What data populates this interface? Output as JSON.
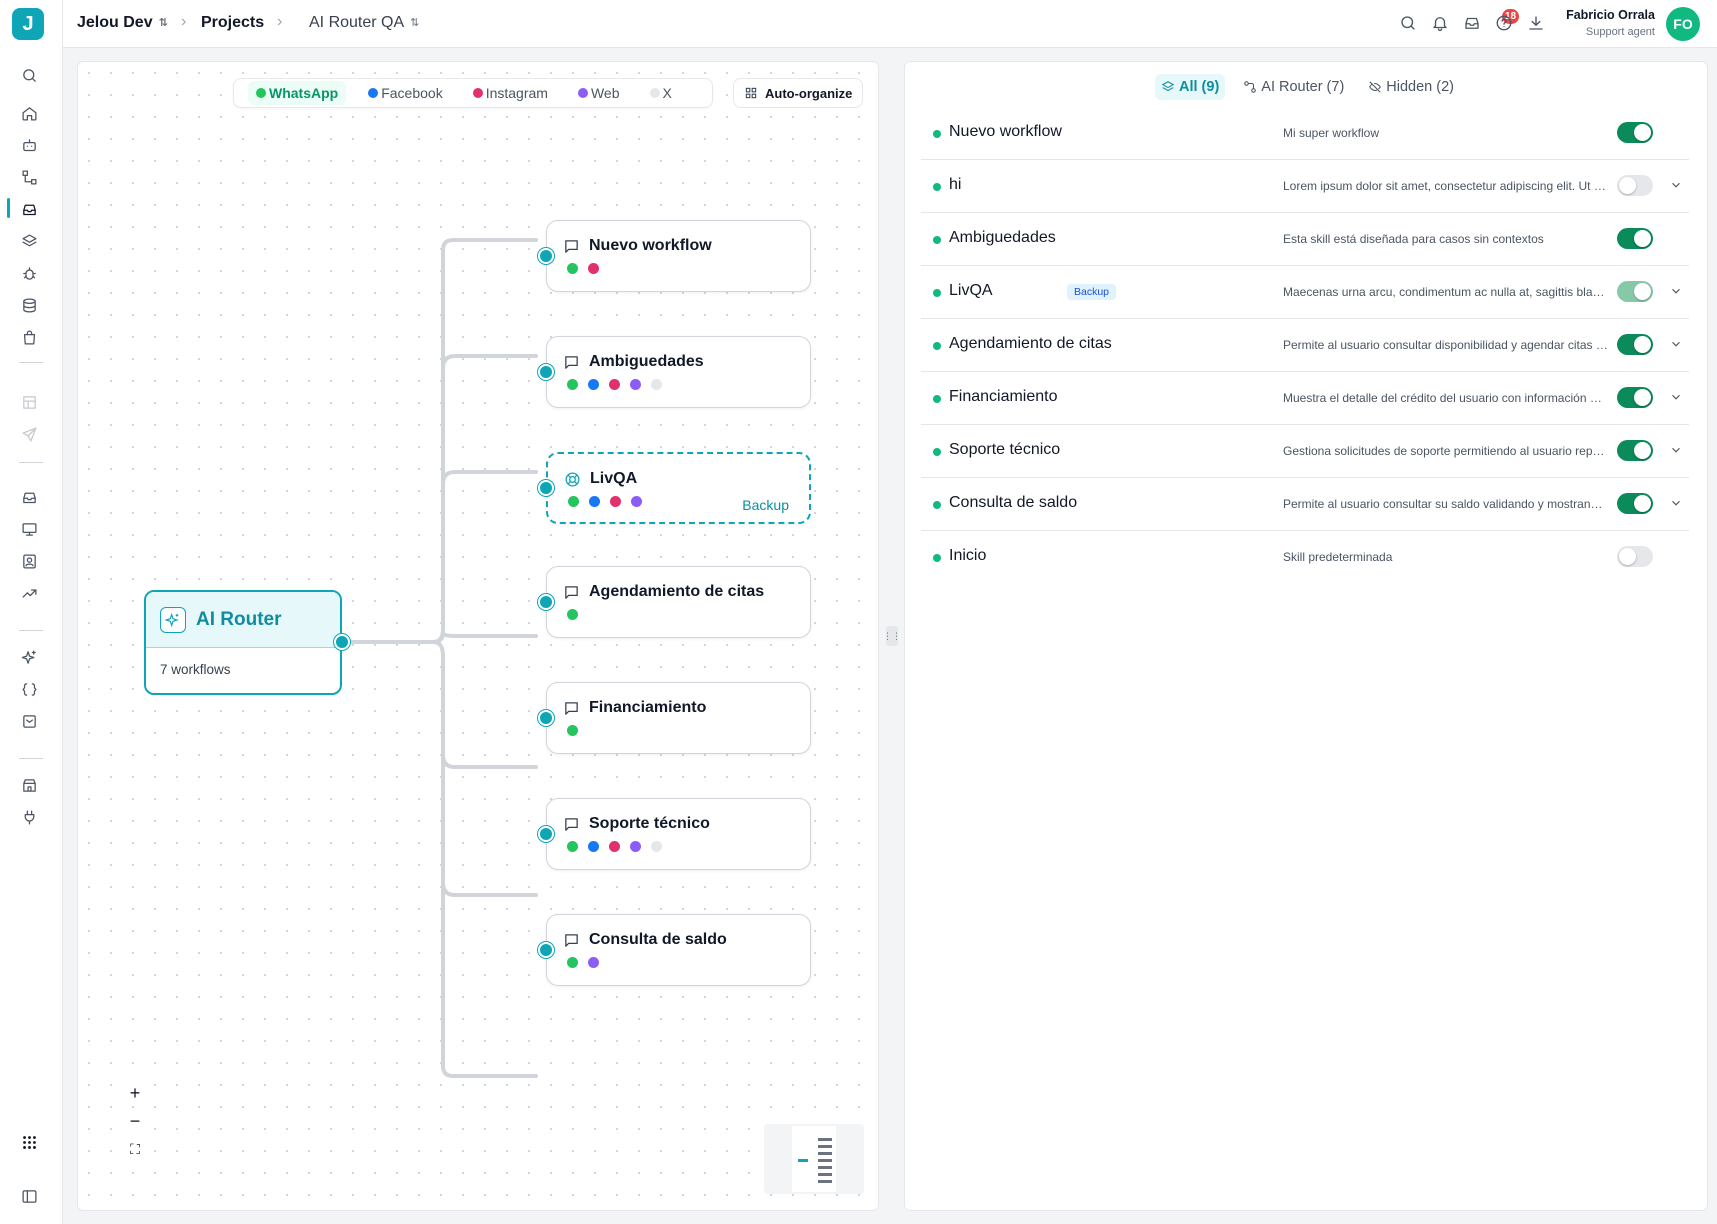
{
  "app": {
    "logo": "J"
  },
  "breadcrumb": {
    "workspace": "Jelou Dev",
    "section": "Projects",
    "project": "AI Router QA"
  },
  "colors": {
    "accent": "#0ea5b7",
    "success": "#0b8a5a",
    "whatsapp": "#22c55e",
    "facebook": "#1877f2",
    "instagram": "#e1306c",
    "web": "#8b5cf6",
    "danger": "#ef4444"
  },
  "notifications": {
    "count": "18"
  },
  "user": {
    "name": "Fabricio Orrala",
    "role": "Support agent",
    "initials": "FO"
  },
  "sidebar": {
    "icons": [
      "search-icon",
      "home-icon",
      "bot-icon",
      "flow-icon",
      "inbox-stack-icon",
      "layers-icon",
      "bug-icon",
      "database-icon",
      "bag-icon",
      "template-icon",
      "send-icon",
      "tray-icon",
      "monitor-icon",
      "contact-icon",
      "trending-icon",
      "sparkles-icon",
      "braces-icon",
      "archive-icon",
      "store-icon",
      "plug-icon",
      "apps-grid-icon",
      "panel-toggle-icon"
    ]
  },
  "canvas": {
    "channels": [
      {
        "label": "WhatsApp",
        "active": true,
        "color": "#22c55e"
      },
      {
        "label": "Facebook",
        "active": false,
        "color": "#1877f2"
      },
      {
        "label": "Instagram",
        "active": false,
        "color": "#e1306c"
      },
      {
        "label": "Web",
        "active": false,
        "color": "#8b5cf6"
      },
      {
        "label": "X",
        "active": false,
        "color": "#e5e7eb"
      }
    ],
    "auto_organize": "Auto-organize",
    "router": {
      "title": "AI Router",
      "subtitle": "7 workflows"
    },
    "workflows": [
      {
        "title": "Nuevo workflow",
        "icon": "chat-icon",
        "channels": [
          "whatsapp",
          "instagram"
        ],
        "badge": ""
      },
      {
        "title": "Ambiguedades",
        "icon": "chat-icon",
        "channels": [
          "whatsapp",
          "facebook",
          "instagram",
          "web",
          "x"
        ],
        "badge": ""
      },
      {
        "title": "LivQA",
        "icon": "lifebuoy-icon",
        "channels": [
          "whatsapp",
          "facebook",
          "instagram",
          "web"
        ],
        "badge": "Backup"
      },
      {
        "title": "Agendamiento de citas",
        "icon": "chat-icon",
        "channels": [
          "whatsapp"
        ],
        "badge": ""
      },
      {
        "title": "Financiamiento",
        "icon": "chat-icon",
        "channels": [
          "whatsapp"
        ],
        "badge": ""
      },
      {
        "title": "Soporte técnico",
        "icon": "chat-icon",
        "channels": [
          "whatsapp",
          "facebook",
          "instagram",
          "web",
          "x"
        ],
        "badge": ""
      },
      {
        "title": "Consulta de saldo",
        "icon": "chat-icon",
        "channels": [
          "whatsapp",
          "web"
        ],
        "badge": ""
      }
    ],
    "zoom": {
      "in": "+",
      "out": "−",
      "fit": "⛶"
    }
  },
  "panel": {
    "tabs": [
      {
        "label": "All (9)",
        "active": true,
        "icon": "layers-icon"
      },
      {
        "label": "AI Router (7)",
        "active": false,
        "icon": "router-icon"
      },
      {
        "label": "Hidden (2)",
        "active": false,
        "icon": "eye-off-icon"
      }
    ],
    "skills": [
      {
        "name": "Nuevo workflow",
        "badge": "",
        "description": "Mi super workflow",
        "enabled": true,
        "expandable": false
      },
      {
        "name": "hi",
        "badge": "",
        "description": "Lorem ipsum dolor sit amet, consectetur adipiscing elit. Ut in m...",
        "enabled": false,
        "expandable": true
      },
      {
        "name": "Ambiguedades",
        "badge": "",
        "description": "Esta skill está diseñada para casos sin contextos",
        "enabled": true,
        "expandable": false
      },
      {
        "name": "LivQA",
        "badge": "Backup",
        "description": "Maecenas urna arcu, condimentum ac nulla at, sagittis blandit f...",
        "enabled": true,
        "muted": true,
        "expandable": true
      },
      {
        "name": "Agendamiento de citas",
        "badge": "",
        "description": "Permite al usuario consultar disponibilidad y agendar citas rela...",
        "enabled": true,
        "expandable": true
      },
      {
        "name": "Financiamiento",
        "badge": "",
        "description": "Muestra el detalle del crédito del usuario con información actu...",
        "enabled": true,
        "expandable": true
      },
      {
        "name": "Soporte técnico",
        "badge": "",
        "description": "Gestiona solicitudes de soporte permitiendo al usuario reporta...",
        "enabled": true,
        "expandable": true
      },
      {
        "name": "Consulta de saldo",
        "badge": "",
        "description": "Permite al usuario consultar su saldo validando y mostrando inf...",
        "enabled": true,
        "expandable": true
      },
      {
        "name": "Inicio",
        "badge": "",
        "description": "Skill predeterminada",
        "enabled": false,
        "expandable": false
      }
    ]
  }
}
